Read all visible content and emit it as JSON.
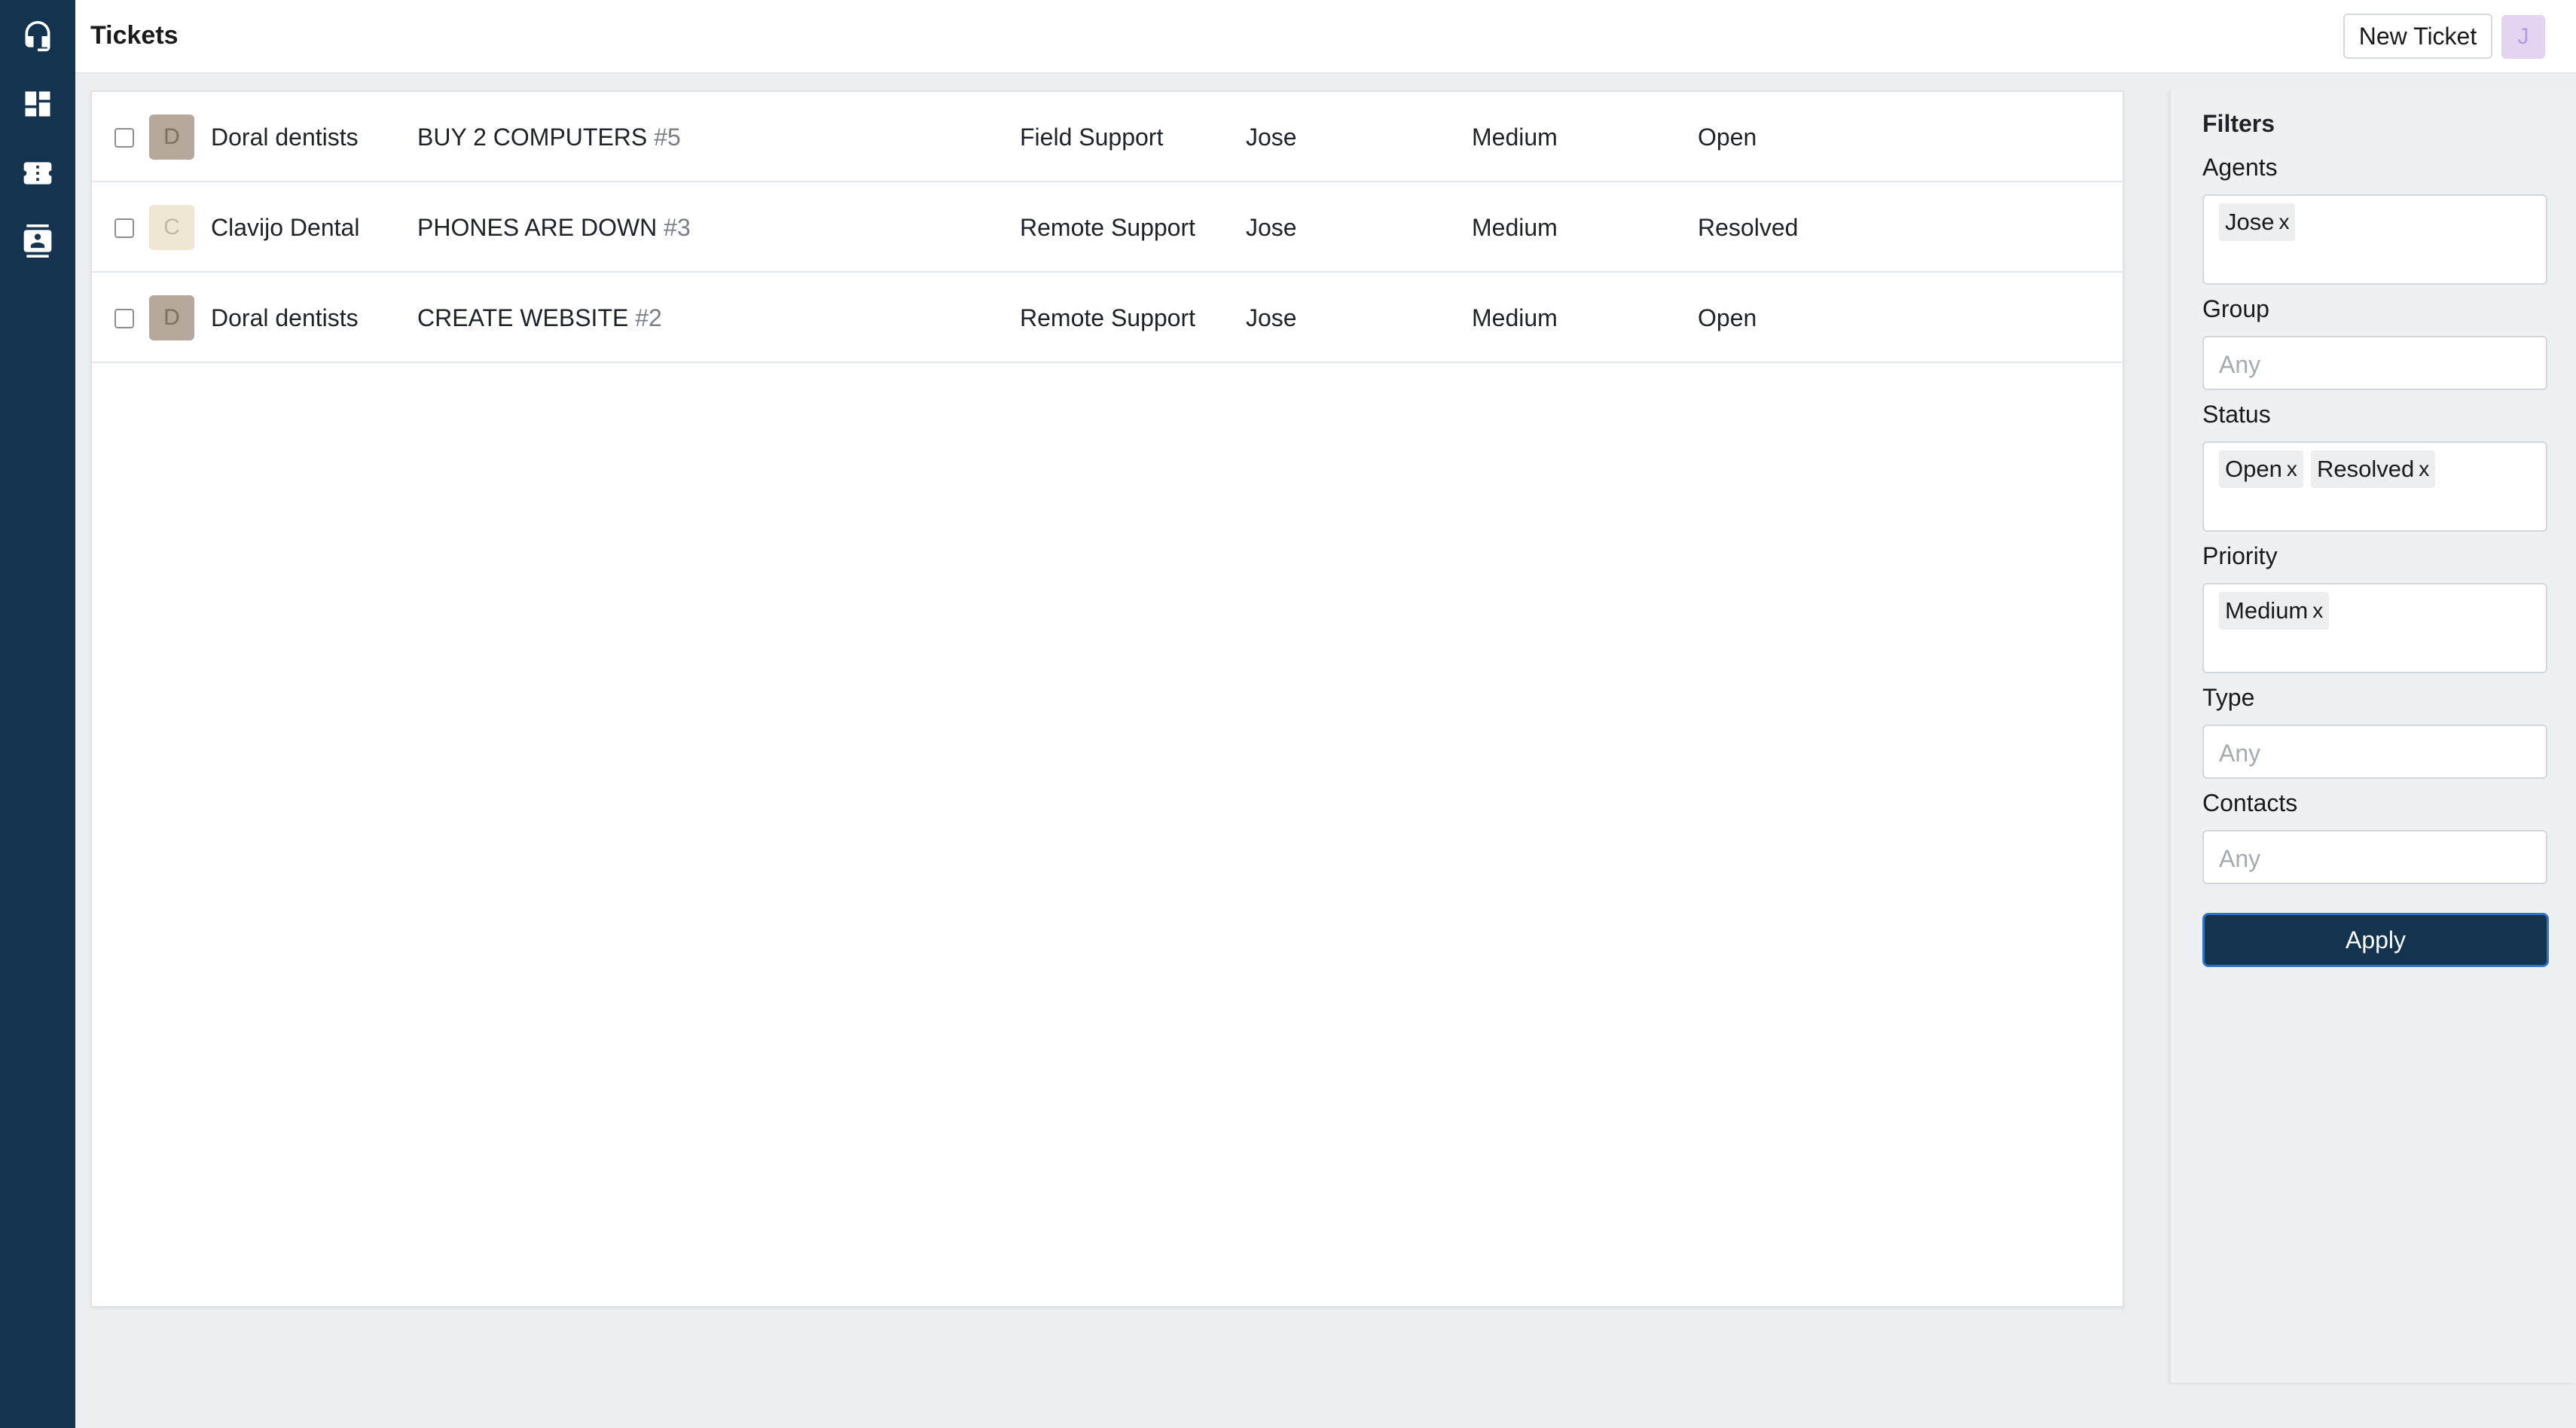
{
  "sidebar": {
    "icons": [
      "headset-icon",
      "dashboard-icon",
      "ticket-icon",
      "contacts-icon"
    ]
  },
  "header": {
    "title": "Tickets",
    "new_ticket_label": "New Ticket",
    "user_initial": "J"
  },
  "tickets": [
    {
      "initial": "D",
      "avatar_bg": "#b5a89a",
      "avatar_fg": "#7d6f62",
      "contact": "Doral dentists",
      "subject": "BUY 2 COMPUTERS",
      "number": "#5",
      "group": "Field Support",
      "agent": "Jose",
      "priority": "Medium",
      "status": "Open"
    },
    {
      "initial": "C",
      "avatar_bg": "#efe6d3",
      "avatar_fg": "#c2b79f",
      "contact": "Clavijo Dental",
      "subject": "PHONES ARE DOWN",
      "number": "#3",
      "group": "Remote Support",
      "agent": "Jose",
      "priority": "Medium",
      "status": "Resolved"
    },
    {
      "initial": "D",
      "avatar_bg": "#b5a89a",
      "avatar_fg": "#7d6f62",
      "contact": "Doral dentists",
      "subject": "CREATE WEBSITE",
      "number": "#2",
      "group": "Remote Support",
      "agent": "Jose",
      "priority": "Medium",
      "status": "Open"
    }
  ],
  "filters": {
    "title": "Filters",
    "agents": {
      "label": "Agents",
      "chips": [
        "Jose"
      ]
    },
    "group": {
      "label": "Group",
      "placeholder": "Any"
    },
    "status": {
      "label": "Status",
      "chips": [
        "Open",
        "Resolved"
      ]
    },
    "priority": {
      "label": "Priority",
      "chips": [
        "Medium"
      ]
    },
    "type": {
      "label": "Type",
      "placeholder": "Any"
    },
    "contacts": {
      "label": "Contacts",
      "placeholder": "Any"
    },
    "remove_glyph": "x",
    "apply_label": "Apply"
  }
}
